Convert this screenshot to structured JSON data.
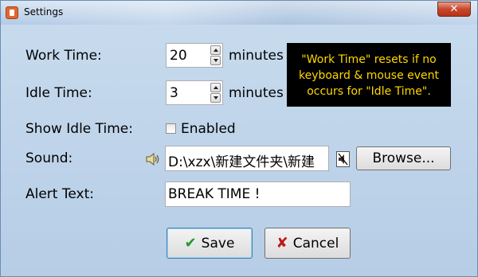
{
  "window": {
    "title": "Settings",
    "close_label": "✕"
  },
  "fields": {
    "work_time_label": "Work Time:",
    "work_time_value": "20",
    "work_time_unit": "minutes",
    "idle_time_label": "Idle Time:",
    "idle_time_value": "3",
    "idle_time_unit": "minutes",
    "show_idle_label": "Show Idle Time:",
    "show_idle_checkbox_label": "Enabled",
    "sound_label": "Sound:",
    "sound_value": "D:\\xzx\\新建文件夹\\新建",
    "alert_label": "Alert Text:",
    "alert_value": "BREAK TIME !"
  },
  "tooltip": {
    "line1": "\"Work Time\" resets if no",
    "line2": "keyboard & mouse event",
    "line3": "occurs for \"Idle Time\"."
  },
  "buttons": {
    "browse": "Browse...",
    "save": "Save",
    "cancel": "Cancel"
  },
  "icons": {
    "app": "timer-app-icon",
    "speaker": "speaker-icon",
    "mute": "mute-icon",
    "save": "check-icon",
    "cancel": "x-icon"
  },
  "colors": {
    "tooltip_bg": "#000000",
    "tooltip_text": "#ffd700",
    "save_icon": "#1e9a2c",
    "cancel_icon": "#c01818"
  }
}
